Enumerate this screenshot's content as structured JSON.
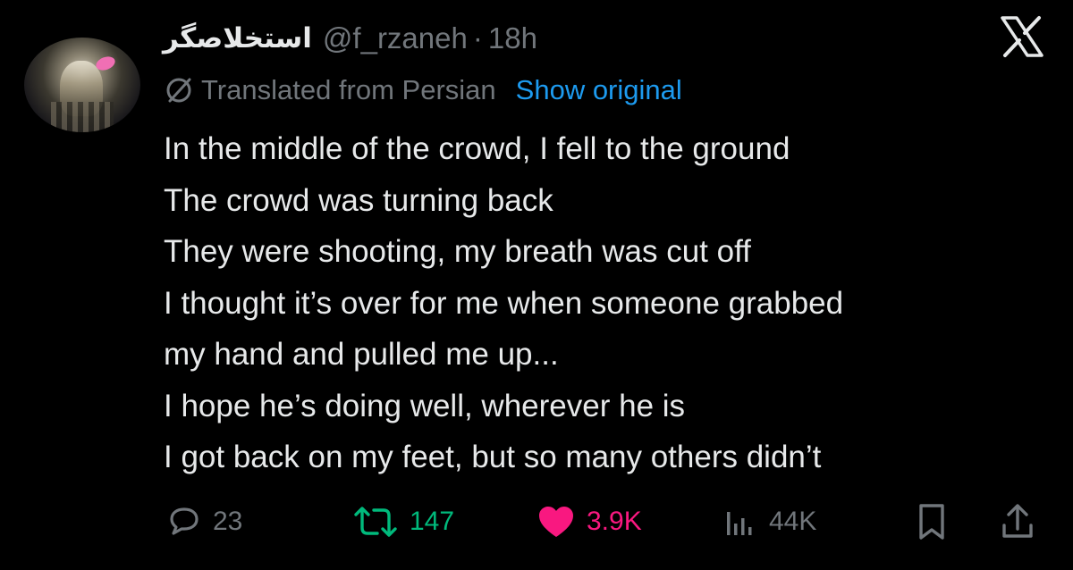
{
  "tweet": {
    "display_name": "استخلاصگر",
    "handle": "@f_rzaneh",
    "separator": "·",
    "time": "18h",
    "translation_notice": "Translated from Persian",
    "show_original_label": "Show original",
    "lines": [
      "In the middle of the crowd, I fell to the ground",
      "The crowd was turning back",
      "They were shooting, my breath was cut off",
      "I thought it’s over for me when someone grabbed",
      "my hand and pulled me up...",
      "I hope he’s doing well, wherever he is",
      "I got back on my feet, but so many others didn’t"
    ]
  },
  "actions": {
    "reply": {
      "icon": "reply-icon",
      "count": "23"
    },
    "retweet": {
      "icon": "retweet-icon",
      "count": "147",
      "color": "#00ba7c"
    },
    "like": {
      "icon": "heart-icon",
      "count": "3.9K",
      "color": "#f91880"
    },
    "views": {
      "icon": "views-icon",
      "count": "44K"
    },
    "bookmark": {
      "icon": "bookmark-icon"
    },
    "share": {
      "icon": "share-icon"
    }
  },
  "colors": {
    "background": "#000000",
    "text": "#e7e9ea",
    "muted": "#71767b",
    "link": "#1d9bf0"
  },
  "brand": {
    "logo": "x-logo-icon"
  }
}
